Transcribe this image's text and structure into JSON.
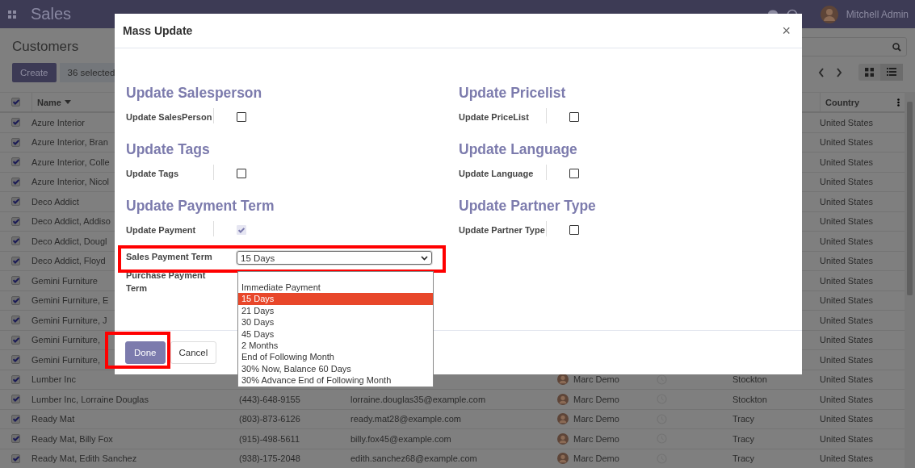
{
  "navbar": {
    "app_name": "Sales",
    "user": "Mitchell Admin"
  },
  "control_panel": {
    "title": "Customers",
    "create": "Create",
    "selected_count": "36 selected"
  },
  "table": {
    "columns": [
      {
        "kind": "check",
        "checked": true
      },
      {
        "kind": "name",
        "label": "Name"
      },
      {
        "kind": "blank"
      },
      {
        "kind": "blank"
      },
      {
        "kind": "blank"
      },
      {
        "kind": "blank"
      },
      {
        "kind": "blank"
      },
      {
        "kind": "country",
        "label": "Country"
      }
    ],
    "rows": [
      {
        "checked": true,
        "name": "Azure Interior",
        "country": "United States"
      },
      {
        "checked": true,
        "name": "Azure Interior, Bran",
        "country": "United States"
      },
      {
        "checked": true,
        "name": "Azure Interior, Colle",
        "country": "United States"
      },
      {
        "checked": true,
        "name": "Azure Interior, Nicol",
        "country": "United States"
      },
      {
        "checked": true,
        "name": "Deco Addict",
        "country": "United States"
      },
      {
        "checked": true,
        "name": "Deco Addict, Addiso",
        "country": "United States"
      },
      {
        "checked": true,
        "name": "Deco Addict, Dougl",
        "country": "United States"
      },
      {
        "checked": true,
        "name": "Deco Addict, Floyd",
        "country": "United States"
      },
      {
        "checked": true,
        "name": "Gemini Furniture",
        "country": "United States"
      },
      {
        "checked": true,
        "name": "Gemini Furniture, E",
        "country": "United States"
      },
      {
        "checked": true,
        "name": "Gemini Furniture, J",
        "country": "United States"
      },
      {
        "checked": true,
        "name": "Gemini Furniture,",
        "country": "United States"
      },
      {
        "checked": true,
        "name": "Gemini Furniture,",
        "country": "United States"
      },
      {
        "checked": true,
        "name": "Lumber Inc",
        "salesperson": "Marc Demo",
        "activity": true,
        "city": "Stockton",
        "country": "United States"
      },
      {
        "checked": true,
        "name": "Lumber Inc, Lorraine Douglas",
        "phone": "(443)-648-9155",
        "email": "lorraine.douglas35@example.com",
        "salesperson": "Marc Demo",
        "activity": true,
        "city": "Stockton",
        "country": "United States"
      },
      {
        "checked": true,
        "name": "Ready Mat",
        "phone": "(803)-873-6126",
        "email": "ready.mat28@example.com",
        "salesperson": "Marc Demo",
        "activity": true,
        "city": "Tracy",
        "country": "United States"
      },
      {
        "checked": true,
        "name": "Ready Mat, Billy Fox",
        "phone": "(915)-498-5611",
        "email": "billy.fox45@example.com",
        "salesperson": "Marc Demo",
        "activity": true,
        "city": "Tracy",
        "country": "United States"
      },
      {
        "checked": true,
        "name": "Ready Mat, Edith Sanchez",
        "phone": "(938)-175-2048",
        "email": "edith.sanchez68@example.com",
        "salesperson": "Marc Demo",
        "activity": true,
        "city": "Tracy",
        "country": "United States"
      }
    ]
  },
  "dialog": {
    "title": "Mass Update",
    "close": "×",
    "columns": [
      [
        {
          "title": "Update Salesperson",
          "fields": [
            {
              "kind": "checkbox",
              "label": "Update SalesPerson",
              "checked": false
            }
          ]
        },
        {
          "title": "Update Tags",
          "fields": [
            {
              "kind": "checkbox",
              "label": "Update Tags",
              "checked": false
            }
          ]
        },
        {
          "title": "Update Payment Term",
          "fields": [
            {
              "kind": "checkbox",
              "label": "Update Payment",
              "checked": true
            },
            {
              "kind": "select",
              "label": "Sales Payment Term",
              "value": "15 Days",
              "highlighted": true,
              "expanded": true
            },
            {
              "kind": "select",
              "label": "Purchase Payment Term"
            }
          ]
        }
      ],
      [
        {
          "title": "Update Pricelist",
          "fields": [
            {
              "kind": "checkbox",
              "label": "Update PriceList",
              "checked": false
            }
          ]
        },
        {
          "title": "Update Language",
          "fields": [
            {
              "kind": "checkbox",
              "label": "Update Language",
              "checked": false
            }
          ]
        },
        {
          "title": "Update Partner Type",
          "fields": [
            {
              "kind": "checkbox",
              "label": "Update Partner Type",
              "checked": false
            }
          ]
        }
      ]
    ],
    "options": [
      {
        "label": "Immediate Payment",
        "selected": false
      },
      {
        "label": "15 Days",
        "selected": true
      },
      {
        "label": "21 Days",
        "selected": false
      },
      {
        "label": "30 Days",
        "selected": false
      },
      {
        "label": "45 Days",
        "selected": false
      },
      {
        "label": "2 Months",
        "selected": false
      },
      {
        "label": "End of Following Month",
        "selected": false
      },
      {
        "label": "30% Now, Balance 60 Days",
        "selected": false
      },
      {
        "label": "30% Advance End of Following Month",
        "selected": false
      }
    ],
    "buttons": [
      {
        "label": "Done",
        "kind": "primary",
        "highlighted": true
      },
      {
        "label": "Cancel",
        "kind": "secondary",
        "highlighted": false
      }
    ]
  }
}
